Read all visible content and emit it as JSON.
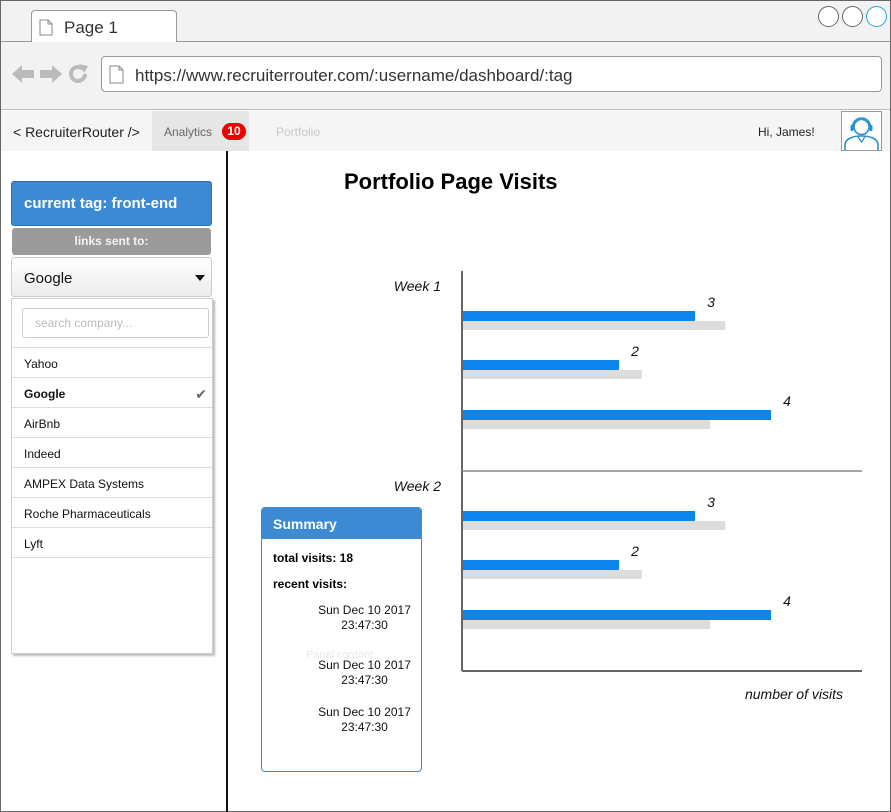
{
  "browser": {
    "tab_title": "Page 1",
    "url": "https://www.recruiterrouter.com/:username/dashboard/:tag"
  },
  "nav": {
    "brand": "< RecruiterRouter />",
    "analytics_label": "Analytics",
    "analytics_badge": "10",
    "portfolio_label": "Portfolio",
    "greeting": "Hi, James!"
  },
  "sidebar": {
    "current_tag": "current tag: front-end",
    "links_sent_label": "links sent to:",
    "selected_company": "Google",
    "search_placeholder": "search company...",
    "companies": [
      {
        "name": "Yahoo",
        "selected": false
      },
      {
        "name": "Google",
        "selected": true
      },
      {
        "name": "AirBnb",
        "selected": false
      },
      {
        "name": "Indeed",
        "selected": false
      },
      {
        "name": "AMPEX Data Systems",
        "selected": false
      },
      {
        "name": "Roche Pharmaceuticals",
        "selected": false
      },
      {
        "name": "Lyft",
        "selected": false
      }
    ],
    "check_glyph": "✔"
  },
  "main": {
    "title": "Portfolio Page Visits"
  },
  "summary": {
    "header": "Summary",
    "total_visits": "total visits: 18",
    "recent_label": "recent visits:",
    "ghost_text": "Panel content",
    "visits": [
      {
        "date": "Sun Dec 10 2017",
        "time": "23:47:30"
      },
      {
        "date": "Sun Dec 10 2017",
        "time": "23:47:30"
      },
      {
        "date": "Sun Dec 10 2017",
        "time": "23:47:30"
      }
    ]
  },
  "colors": {
    "primary": "#0a85ee",
    "secondary": "#dcdcdc",
    "accent": "#3b8ad3",
    "badge": "#ee0000"
  },
  "chart_data": {
    "type": "bar",
    "orientation": "horizontal",
    "title": "Portfolio Page Visits",
    "xlabel": "number of visits",
    "ylabel": "",
    "xlim": [
      0,
      4.5
    ],
    "groups": [
      {
        "label": "Week 1",
        "bars": [
          {
            "value": 3,
            "compare": 3.4
          },
          {
            "value": 2,
            "compare": 2.3
          },
          {
            "value": 4,
            "compare": 3.2
          }
        ]
      },
      {
        "label": "Week 2",
        "bars": [
          {
            "value": 3,
            "compare": 3.4
          },
          {
            "value": 2,
            "compare": 2.3
          },
          {
            "value": 4,
            "compare": 3.2
          }
        ]
      }
    ]
  }
}
